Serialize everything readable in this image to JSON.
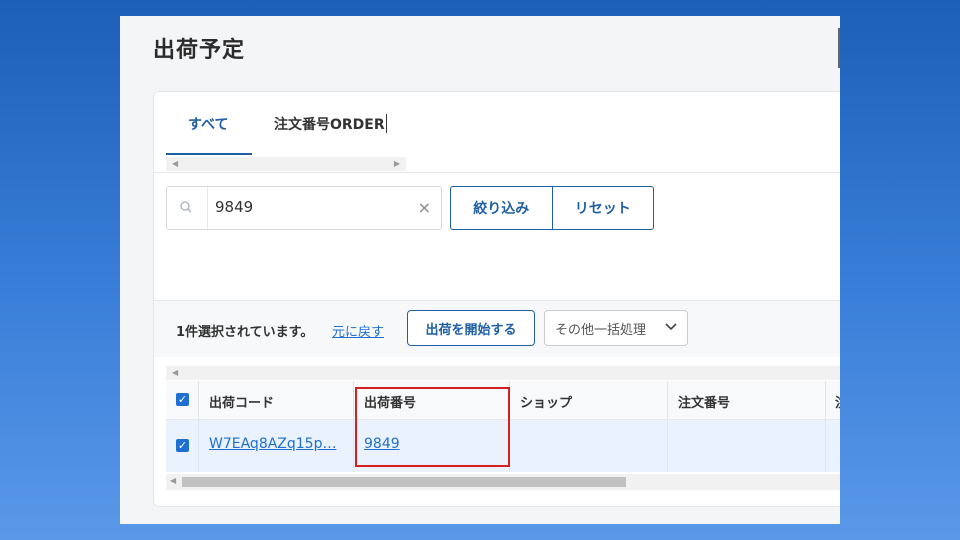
{
  "page": {
    "title": "出荷予定"
  },
  "tabs": [
    {
      "label": "すべて",
      "active": true
    },
    {
      "label": "注文番号ORDER",
      "active": false
    }
  ],
  "search": {
    "value": "9849",
    "clear_icon": "×"
  },
  "filter": {
    "apply_label": "絞り込み",
    "reset_label": "リセット"
  },
  "bulk": {
    "selected_text": "1件選択されています。",
    "undo_link": "元に戻す",
    "start_button": "出荷を開始する",
    "other_select": "その他一括処理"
  },
  "table": {
    "columns": [
      "出荷コード",
      "出荷番号",
      "ショップ",
      "注文番号",
      "注"
    ],
    "rows": [
      {
        "checked": true,
        "shipping_code": "W7EAq8AZq15p…",
        "shipping_number": "9849",
        "shop": "",
        "order_number": ""
      }
    ]
  },
  "icons": {
    "search": "search-icon",
    "clear": "close-icon",
    "chevron": "chevron-down-icon",
    "checkbox": "checkbox-checked-icon"
  },
  "colors": {
    "accent": "#1f5fa6",
    "link": "#1f6fd1",
    "highlight": "#d42020",
    "selected_row": "#e9f2fd"
  }
}
